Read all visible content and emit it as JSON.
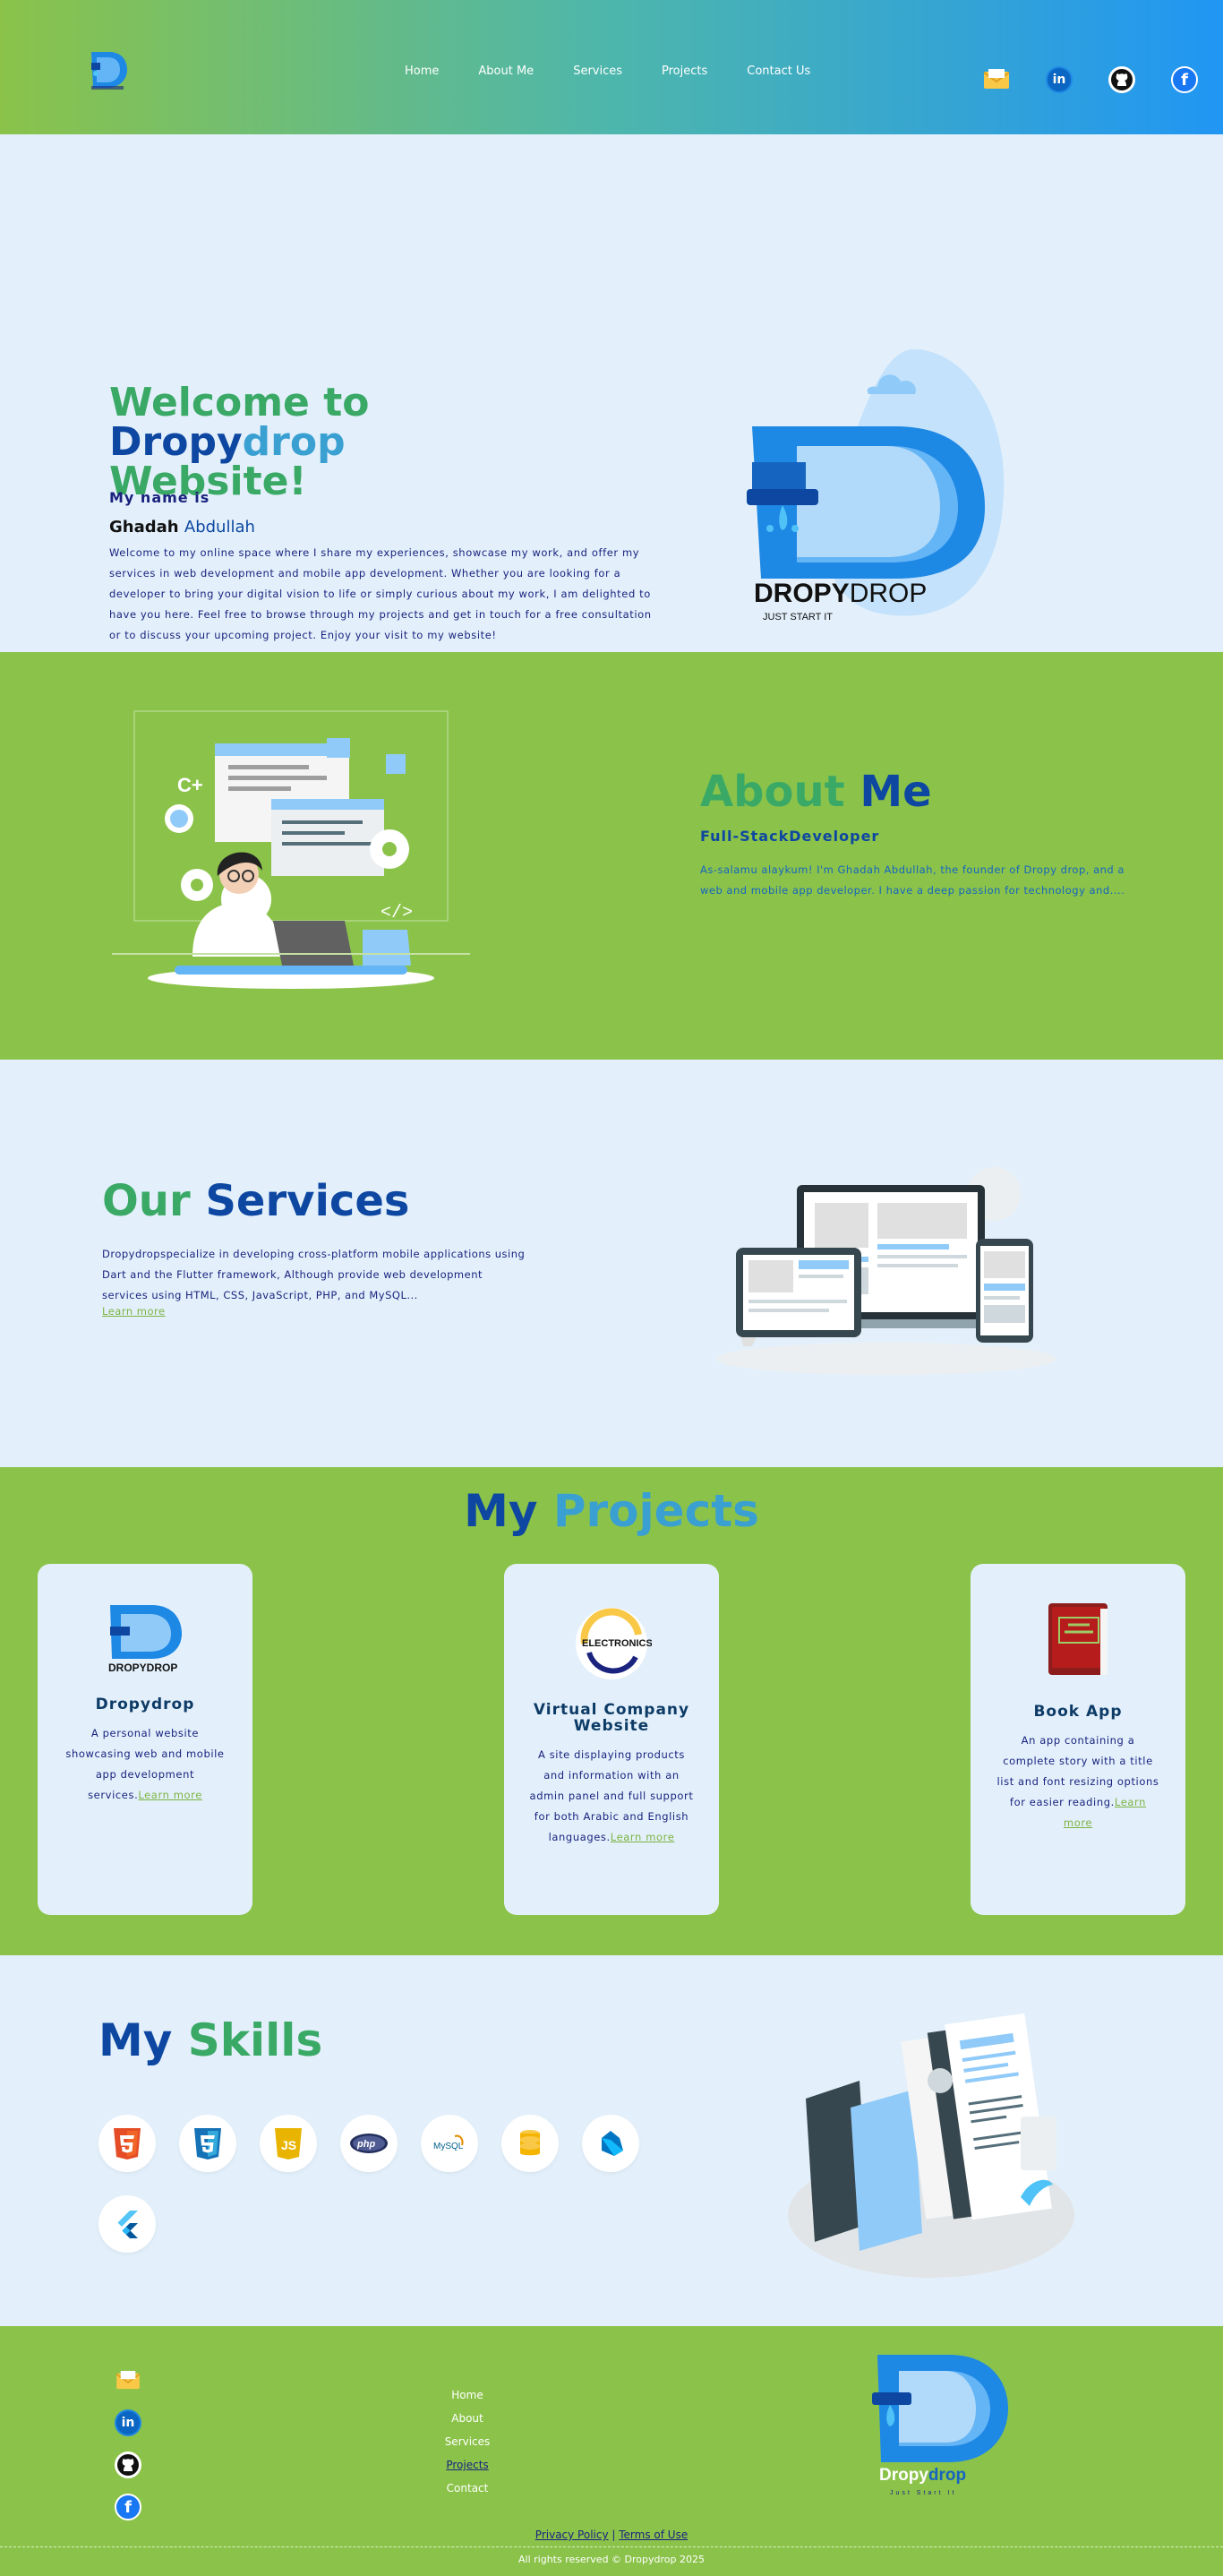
{
  "nav": {
    "items": [
      "Home",
      "About Me",
      "Services",
      "Projects",
      "Contact Us"
    ]
  },
  "social": {
    "icons": [
      "mail-icon",
      "linkedin-icon",
      "github-icon",
      "facebook-icon"
    ],
    "linkedin_label": "in",
    "facebook_label": "f"
  },
  "hero": {
    "title_part1": "Welcome to ",
    "title_brand1": "Dropy",
    "title_brand2": "drop",
    "title_part2": "Website!",
    "my_name_label": "My name is",
    "first_name": "Ghadah",
    "last_name": "Abdullah",
    "intro": "Welcome to my online space where I share my experiences, showcase my work, and offer my services in web development and mobile app development. Whether you are looking for a developer to bring your digital vision to life or simply curious about my work, I am delighted to have you here. Feel free to browse through my projects and get in touch for a free consultation or to discuss your upcoming project. Enjoy your visit to my website!",
    "logo_text_bold": "DROPY",
    "logo_text_light": "DROP",
    "logo_tagline": "JUST START IT"
  },
  "about": {
    "title1": "About ",
    "title2": "Me",
    "role": "Full-StackDeveloper",
    "bio": "As-salamu alaykum! I'm Ghadah Abdullah, the founder of Dropy drop, and a web and mobile app developer. I have a deep passion for technology and...."
  },
  "services": {
    "title1": "Our ",
    "title2": "Services",
    "desc": "Dropydropspecialize in developing cross-platform mobile applications using Dart and the Flutter framework, Although provide web development services using HTML, CSS, JavaScript, PHP, and MySQL...",
    "learn_more": "Learn more"
  },
  "projects": {
    "title1": "My ",
    "title2": "Projects",
    "cards": [
      {
        "title": "Dropydrop",
        "desc": "A personal website showcasing web and mobile app development services.",
        "link": "Learn more",
        "logo_text": "DROPYDROP"
      },
      {
        "title": "Virtual Company Website",
        "desc": "A site displaying products and information with an admin panel and full support for both Arabic and English languages.",
        "link": "Learn more",
        "logo_text": "ELECTRONICS"
      },
      {
        "title": "Book App",
        "desc": "An app containing a complete story with a title list and font resizing options for easier reading.",
        "link": "Learn more"
      }
    ]
  },
  "skills": {
    "title1": "My ",
    "title2": "Skills",
    "icons": [
      "html5-icon",
      "css3-icon",
      "javascript-icon",
      "php-icon",
      "mysql-icon",
      "database-icon",
      "dart-icon",
      "flutter-icon"
    ],
    "js_label": "JS",
    "php_label": "php",
    "mysql_label": "MySQL"
  },
  "footer": {
    "links": [
      "Home",
      "About",
      "Services",
      "Projects",
      "Contact"
    ],
    "brand1": "Dropy",
    "brand2": "drop",
    "tagline": "Just Start It",
    "privacy": "Privacy Policy",
    "separator": " | ",
    "terms": "Terms of Use",
    "copyright": "All rights reserved © Dropydrop 2025"
  },
  "colors": {
    "green": "#8bc34a",
    "blue": "#2196f3",
    "navy": "#0d47a1",
    "light_bg": "#e3f0fb"
  }
}
